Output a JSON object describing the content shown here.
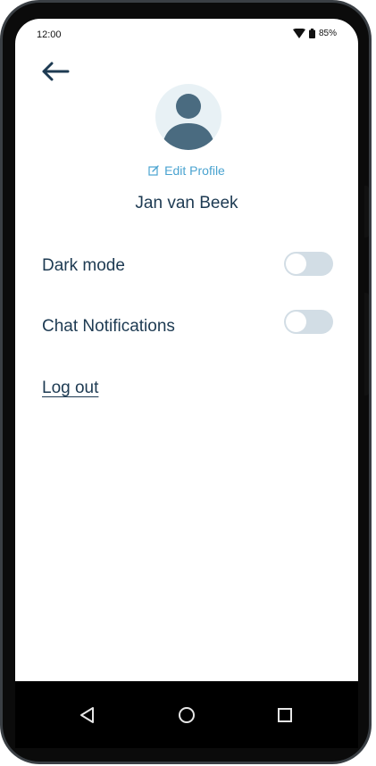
{
  "status_bar": {
    "time": "12:00",
    "battery": "85%",
    "icons": [
      "wifi-icon",
      "battery-icon"
    ]
  },
  "header": {
    "back_icon": "arrow-left-icon"
  },
  "profile": {
    "avatar_icon": "user-avatar-icon",
    "edit_label": "Edit Profile",
    "edit_icon": "edit-icon",
    "name": "Jan van Beek"
  },
  "settings": {
    "dark_mode": {
      "label": "Dark mode",
      "enabled": false
    },
    "chat_notifications": {
      "label": "Chat Notifications",
      "enabled": false
    }
  },
  "logout_label": "Log out",
  "nav": {
    "icons": [
      "back-triangle-icon",
      "home-circle-icon",
      "recent-square-icon"
    ]
  },
  "colors": {
    "text_primary": "#1d3a52",
    "accent": "#4aa3d0",
    "toggle_off": "#d2dde5",
    "avatar_bg": "#e8f1f5",
    "avatar_fg": "#4a6b80"
  }
}
